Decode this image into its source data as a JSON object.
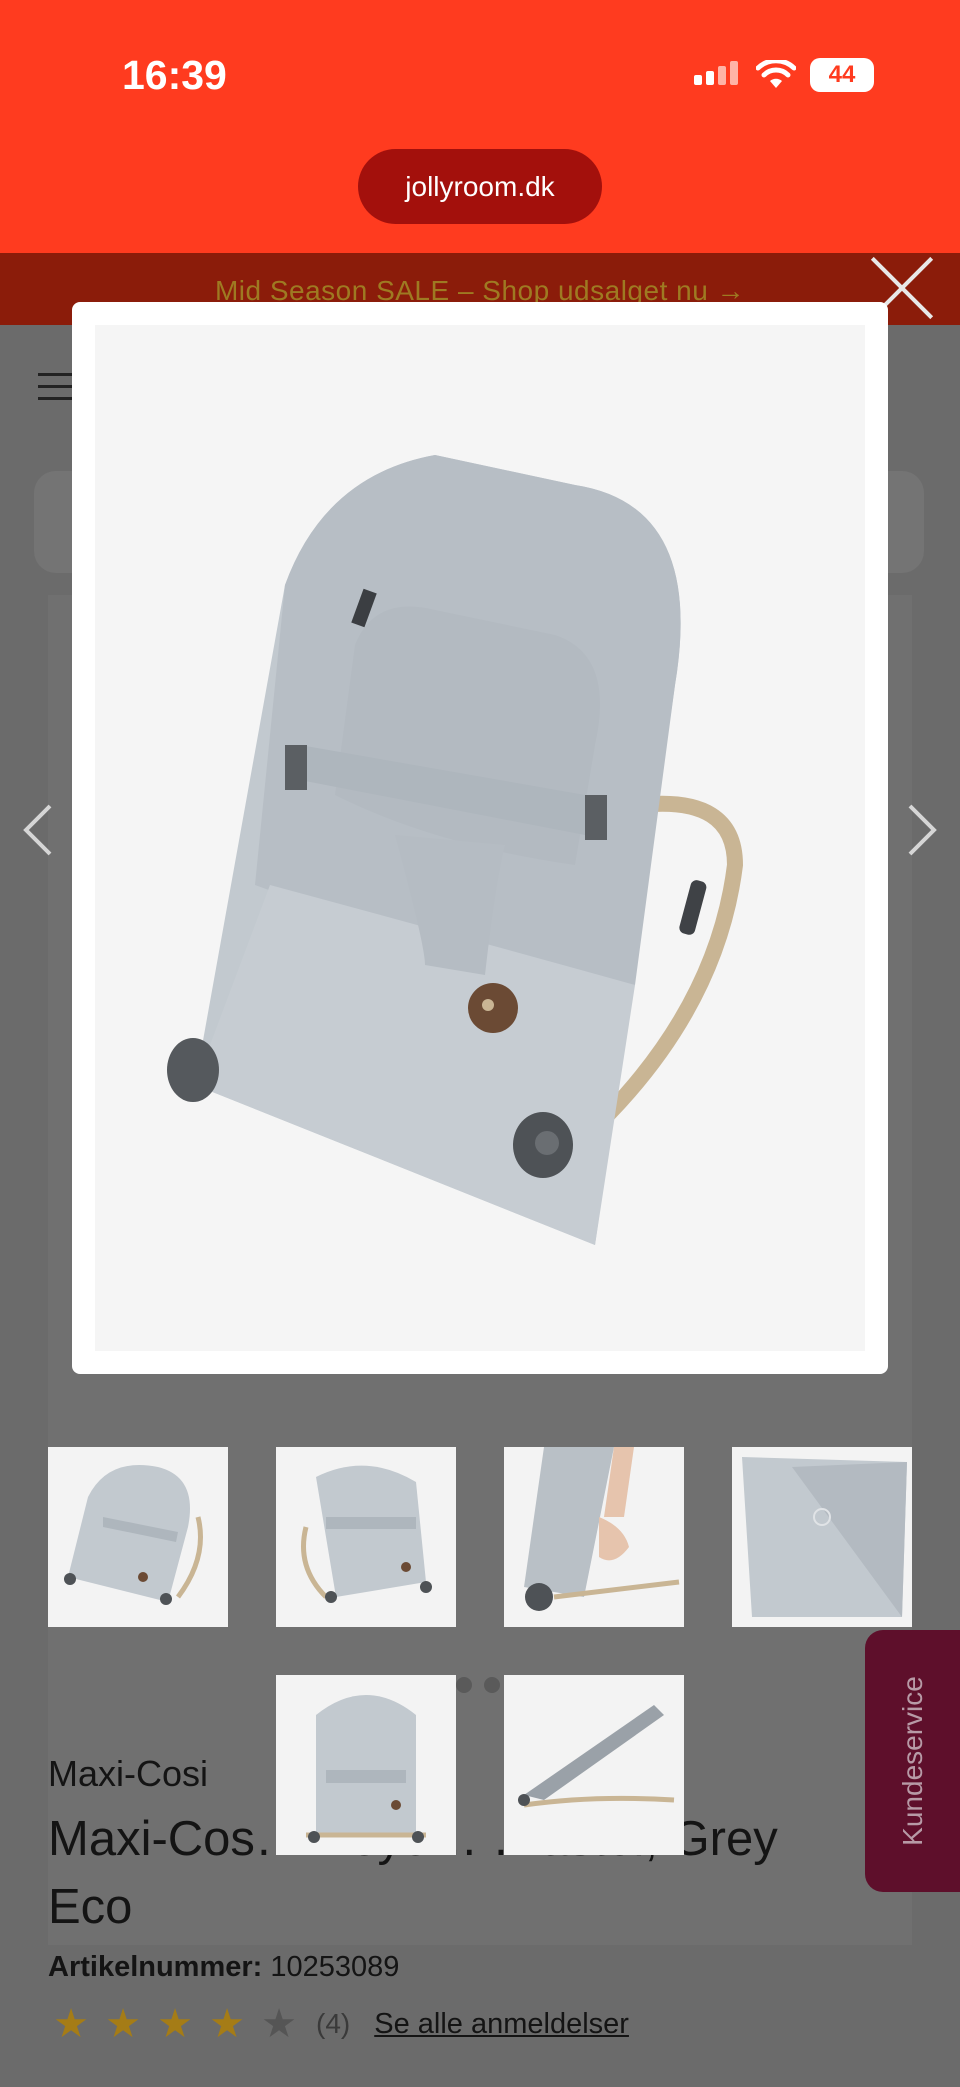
{
  "status": {
    "time": "16:39",
    "battery": "44"
  },
  "browser": {
    "url": "jollyroom.dk"
  },
  "promo": {
    "text": "Mid Season SALE – Shop udsalget nu →"
  },
  "product": {
    "brand": "Maxi-Cosi",
    "title": "Maxi-Cosi Kori Beyond Vippestol, Grey Eco",
    "title_visible": "Maxi-Cos… Beyo… …åstol, Grey Eco",
    "article_label": "Artikelnummer:",
    "article_number": "10253089",
    "rating_value": 4,
    "rating_max": 5,
    "rating_count": "(4)",
    "reviews_link": "Se alle anmeldelser"
  },
  "support": {
    "label": "Kundeservice"
  },
  "gallery": {
    "thumbnails": [
      "bouncer-front",
      "bouncer-angle",
      "bouncer-fold",
      "bouncer-fabric-detail",
      "bouncer-top",
      "bouncer-side"
    ]
  },
  "colors": {
    "header": "#ff3b1f",
    "url_pill": "#a3100c",
    "overlay": "#6b6b6b",
    "fabric": "#c9cfd4",
    "frame": "#c9b594",
    "support_tab": "#5e0f2b"
  }
}
